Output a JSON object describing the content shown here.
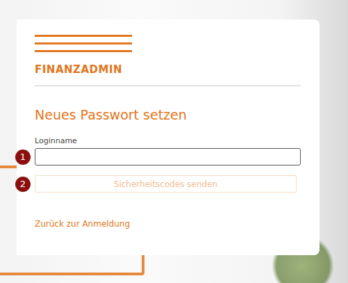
{
  "logo": {
    "text": "FINANZADMIN"
  },
  "title": "Neues Passwort setzen",
  "login_field": {
    "label": "Loginname",
    "value": "",
    "badge": "1"
  },
  "send_button": {
    "label": "Sicherheitscodes senden",
    "disabled": true,
    "badge": "2"
  },
  "back_link": "Zurück zur Anmeldung"
}
